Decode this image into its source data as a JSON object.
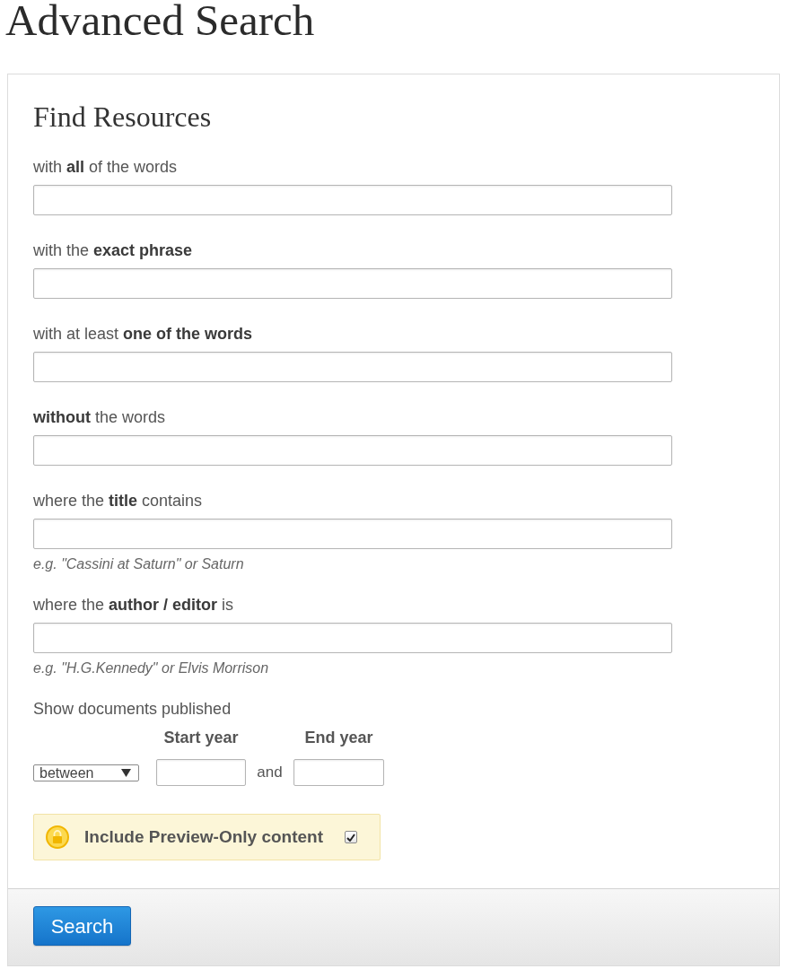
{
  "page": {
    "title": "Advanced Search"
  },
  "panel": {
    "title": "Find Resources",
    "fields": [
      {
        "label": "with **all** of the words"
      },
      {
        "label": "with the **exact phrase**"
      },
      {
        "label": "with at least **one of the words**"
      },
      {
        "label": "**without** the words"
      },
      {
        "label": "where the **title** contains",
        "hint": "e.g. \"Cassini at Saturn\" or Saturn"
      },
      {
        "label": "where the **author / editor** is",
        "hint": "e.g. \"H.G.Kennedy\" or Elvis Morrison"
      }
    ],
    "date_filter": {
      "label": "Show documents published",
      "start_label": "Start year",
      "end_label": "End year",
      "mode": "between",
      "joiner": "and"
    },
    "preview_option": {
      "label": "Include Preview-Only content",
      "checked": true
    }
  },
  "footer": {
    "search_button": "Search"
  }
}
